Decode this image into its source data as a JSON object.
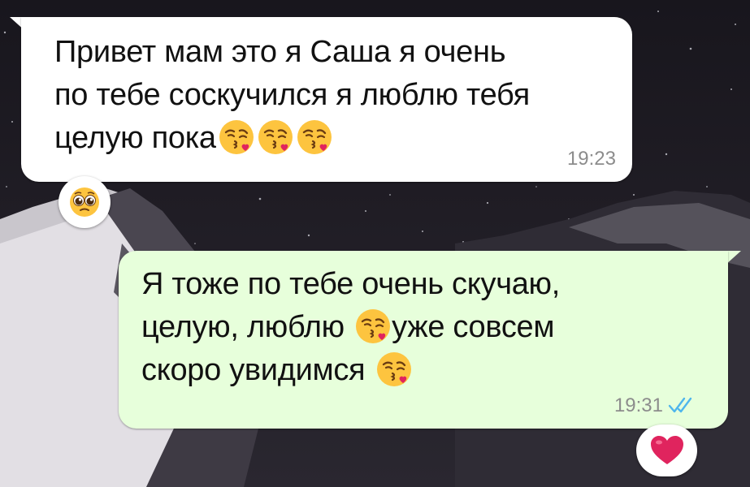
{
  "chat": {
    "incoming": {
      "lines": [
        "Привет мам это я Саша я очень",
        "по тебе соскучился я люблю тебя",
        "целую пока"
      ],
      "time": "19:23",
      "reaction": "pleading-face"
    },
    "outgoing": {
      "lines": [
        "Я тоже по тебе очень скучаю,",
        "целую, люблю",
        "уже совсем",
        "скоро увидимся"
      ],
      "time": "19:31",
      "status": "read-double-check",
      "reaction": "red-heart"
    }
  },
  "icons": {
    "emoji_kiss": "face-blowing-kiss-icon",
    "emoji_pleading": "pleading-face-icon",
    "emoji_heart": "red-heart-icon",
    "ticks": "double-check-icon"
  },
  "colors": {
    "incoming_bubble": "#ffffff",
    "outgoing_bubble": "#e7ffdb",
    "ticks": "#4fb6ec",
    "timestamp": "#8c8c8c"
  }
}
